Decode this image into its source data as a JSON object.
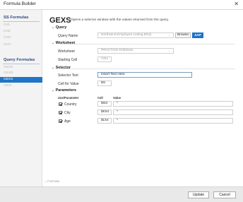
{
  "window": {
    "title": "Formula Builder",
    "close_glyph": "✕"
  },
  "sidebar": {
    "groups": [
      {
        "label": "SS Formulas",
        "items": [
          "GXL",
          "GXE",
          "GXD",
          "GXO"
        ]
      },
      {
        "label": "Query Formulas",
        "items": [
          "GEXS",
          "GEXD",
          "GEXS",
          "GEXI"
        ]
      }
    ],
    "active_item": "GEXS"
  },
  "header": {
    "name": "GEXS",
    "description": "Opens a selector window with the values returned from the query."
  },
  "query": {
    "title": "Query",
    "name_label": "Query Name",
    "name_value": "Northwind Employee Listing.EDQ",
    "browse_label": "Browse",
    "sap_label": "SAP",
    "chevron_icon": "chevron-down-icon"
  },
  "worksheet": {
    "title": "Worksheet",
    "worksheet_label": "Worksheet",
    "worksheet_value": "PRACTICE-Drilldown",
    "cell_label": "Starting Cell",
    "cell_value": "!V54"
  },
  "selector": {
    "title": "Selector",
    "text_label": "Selector Text",
    "text_value": "Insert Text Here",
    "cell_label": "Cell for Value",
    "cell_value": "B5"
  },
  "parameters": {
    "title": "Parameters",
    "col_use": "Use/Parameter",
    "col_cell": "Cell",
    "col_value": "Value",
    "rows": [
      {
        "name": "Country",
        "cell": "$I54",
        "value": "*",
        "checked": true
      },
      {
        "name": "City",
        "cell": "$K54",
        "value": "*",
        "checked": true
      },
      {
        "name": "Age",
        "cell": "$L54",
        "value": "*",
        "checked": true
      }
    ]
  },
  "formula": {
    "title": "Formula"
  },
  "footer": {
    "update_label": "Update",
    "cancel_label": "Cancel"
  },
  "colors": {
    "accent": "#1f75c4",
    "sap_blue": "#1a73c8",
    "footer_bg": "#e9e9e9"
  }
}
